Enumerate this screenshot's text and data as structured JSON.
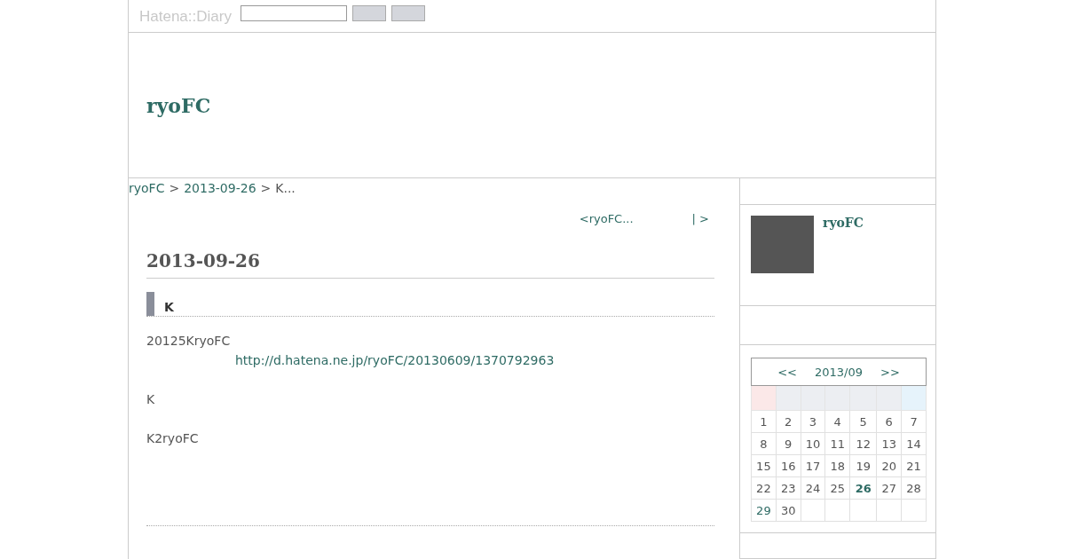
{
  "header": {
    "logo": "Hatena::Diary"
  },
  "blog_title": "ryoFC",
  "breadcrumb": [
    {
      "text": "ryoFC",
      "kind": "link"
    },
    {
      "text": ">",
      "kind": "separator"
    },
    {
      "text": "2013-09-26",
      "kind": "link"
    },
    {
      "text": ">",
      "kind": "separator"
    },
    {
      "text": "K...",
      "kind": "current"
    }
  ],
  "pager": {
    "prev": "<ryoFC...",
    "next": "| >"
  },
  "day": {
    "date": "2013-09-26",
    "section_title": "K",
    "paragraphs": [
      {
        "text": "20125KryoFC",
        "kind": "text"
      },
      {
        "text": "http://d.hatena.ne.jp/ryoFC/20130609/1370792963",
        "kind": "link"
      },
      {
        "text": "K",
        "kind": "text"
      },
      {
        "text": "K2ryoFC",
        "kind": "text"
      }
    ]
  },
  "profile": {
    "name": "ryoFC"
  },
  "calendar": {
    "prev": "<<",
    "month": "2013/09",
    "next": ">>",
    "days": [
      {
        "d": "1",
        "linked": false,
        "selected": false
      },
      {
        "d": "2",
        "linked": false,
        "selected": false
      },
      {
        "d": "3",
        "linked": false,
        "selected": false
      },
      {
        "d": "4",
        "linked": false,
        "selected": false
      },
      {
        "d": "5",
        "linked": false,
        "selected": false
      },
      {
        "d": "6",
        "linked": false,
        "selected": false
      },
      {
        "d": "7",
        "linked": false,
        "selected": false
      },
      {
        "d": "8",
        "linked": false,
        "selected": false
      },
      {
        "d": "9",
        "linked": false,
        "selected": false
      },
      {
        "d": "10",
        "linked": false,
        "selected": false
      },
      {
        "d": "11",
        "linked": false,
        "selected": false
      },
      {
        "d": "12",
        "linked": false,
        "selected": false
      },
      {
        "d": "13",
        "linked": false,
        "selected": false
      },
      {
        "d": "14",
        "linked": false,
        "selected": false
      },
      {
        "d": "15",
        "linked": false,
        "selected": false
      },
      {
        "d": "16",
        "linked": false,
        "selected": false
      },
      {
        "d": "17",
        "linked": false,
        "selected": false
      },
      {
        "d": "18",
        "linked": false,
        "selected": false
      },
      {
        "d": "19",
        "linked": false,
        "selected": false
      },
      {
        "d": "20",
        "linked": false,
        "selected": false
      },
      {
        "d": "21",
        "linked": false,
        "selected": false
      },
      {
        "d": "22",
        "linked": false,
        "selected": false
      },
      {
        "d": "23",
        "linked": false,
        "selected": false
      },
      {
        "d": "24",
        "linked": false,
        "selected": false
      },
      {
        "d": "25",
        "linked": false,
        "selected": false
      },
      {
        "d": "26",
        "linked": true,
        "selected": true
      },
      {
        "d": "27",
        "linked": false,
        "selected": false
      },
      {
        "d": "28",
        "linked": false,
        "selected": false
      },
      {
        "d": "29",
        "linked": true,
        "selected": false
      },
      {
        "d": "30",
        "linked": false,
        "selected": false
      }
    ]
  }
}
